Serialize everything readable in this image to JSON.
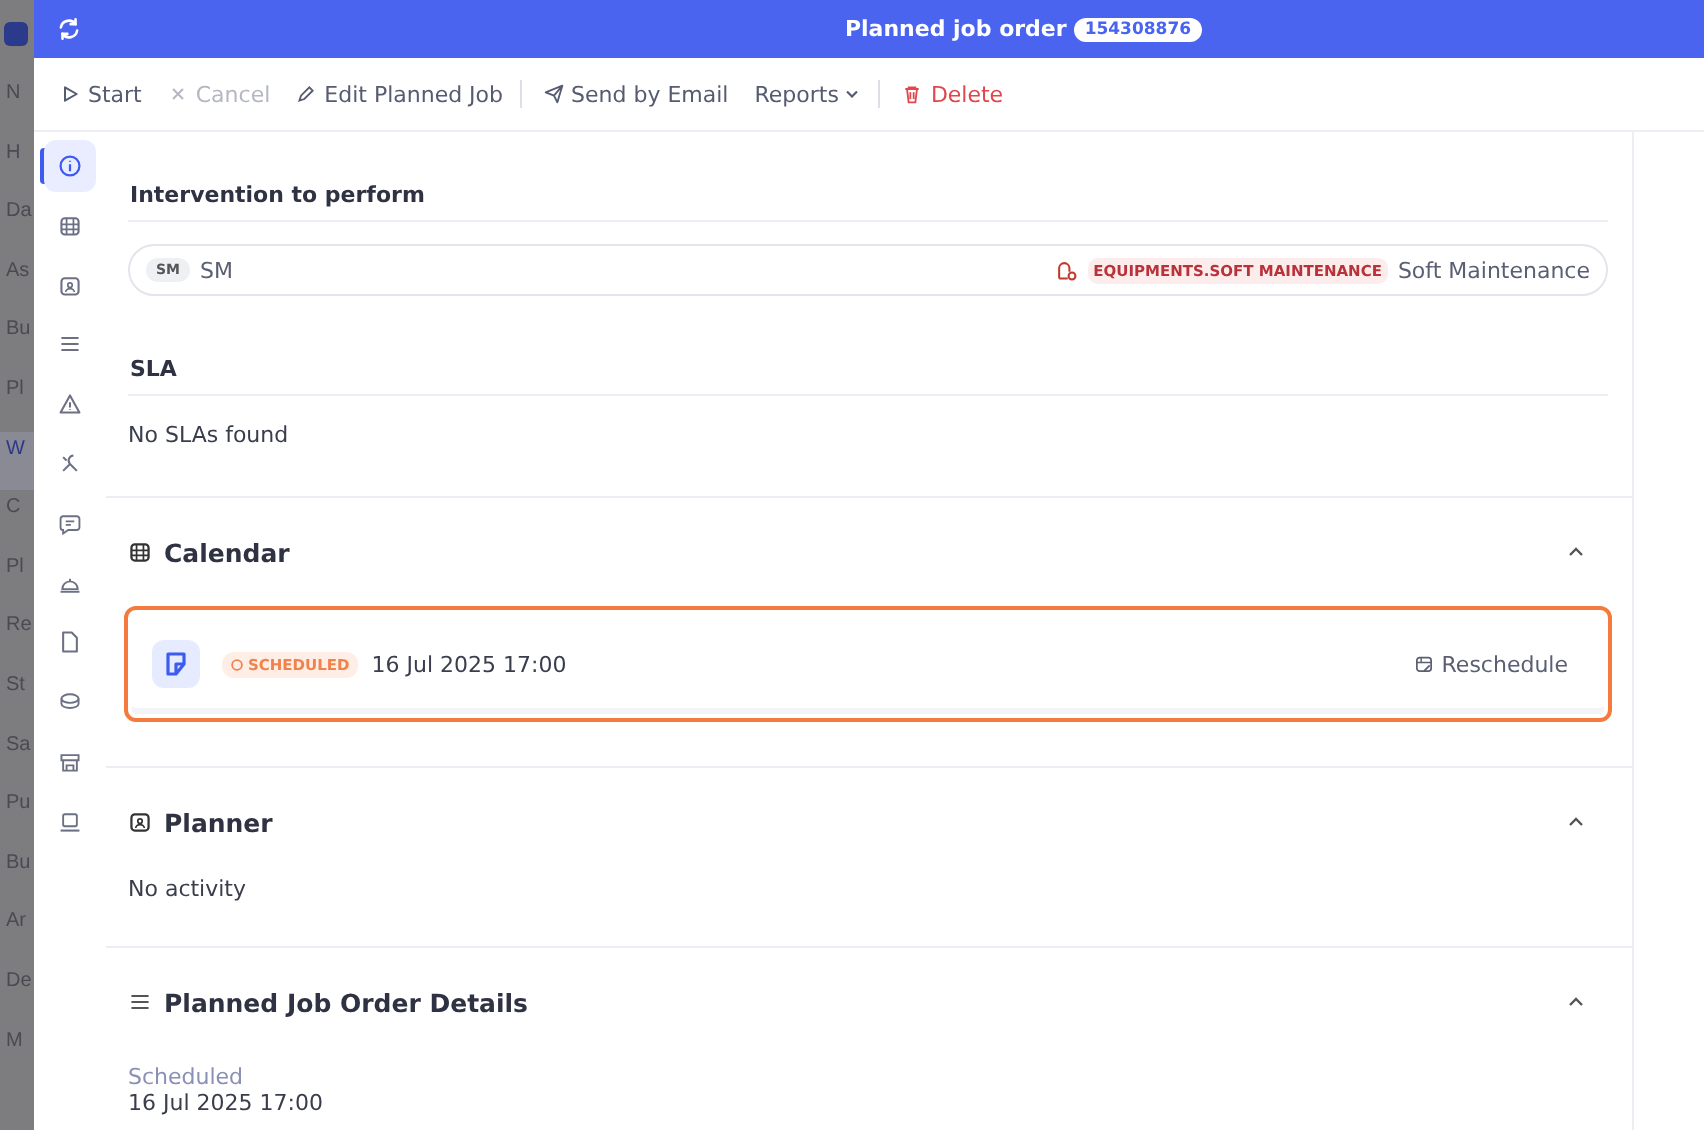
{
  "backdrop_nav": [
    {
      "label": "N",
      "selected": false
    },
    {
      "label": "H",
      "selected": false
    },
    {
      "label": "Da",
      "selected": false
    },
    {
      "label": "As",
      "selected": false
    },
    {
      "label": "Bu",
      "selected": false
    },
    {
      "label": "Pl",
      "selected": false
    },
    {
      "label": "W",
      "selected": true
    },
    {
      "label": "C",
      "selected": false
    },
    {
      "label": "Pl",
      "selected": false
    },
    {
      "label": "Re",
      "selected": false
    },
    {
      "label": "St",
      "selected": false
    },
    {
      "label": "Sa",
      "selected": false
    },
    {
      "label": "Pu",
      "selected": false
    },
    {
      "label": "Bu",
      "selected": false
    },
    {
      "label": "Ar",
      "selected": false
    },
    {
      "label": "De",
      "selected": false
    },
    {
      "label": "M",
      "selected": false
    }
  ],
  "window": {
    "title": "Planned job order",
    "badge": "154308876"
  },
  "toolbar": [
    {
      "kind": "start",
      "label": "Start",
      "disabled": false
    },
    {
      "kind": "cancel",
      "label": "Cancel",
      "disabled": true
    },
    {
      "kind": "edit",
      "label": "Edit Planned Job",
      "disabled": false
    },
    {
      "kind": "email",
      "label": "Send by Email",
      "disabled": false
    },
    {
      "kind": "reports",
      "label": "Reports",
      "disabled": false
    },
    {
      "kind": "delete",
      "label": "Delete",
      "disabled": false
    }
  ],
  "rail": [
    {
      "kind": "info",
      "selected": true
    },
    {
      "kind": "calendar",
      "selected": false
    },
    {
      "kind": "planner",
      "selected": false
    },
    {
      "kind": "list",
      "selected": false
    },
    {
      "kind": "warning",
      "selected": false
    },
    {
      "kind": "tools",
      "selected": false
    },
    {
      "kind": "chat",
      "selected": false
    },
    {
      "kind": "bell",
      "selected": false
    },
    {
      "kind": "file",
      "selected": false
    },
    {
      "kind": "stack",
      "selected": false
    },
    {
      "kind": "store",
      "selected": false
    },
    {
      "kind": "laptop",
      "selected": false
    }
  ],
  "intervention": {
    "title": "Intervention to perform",
    "code": "SM",
    "name": "SM",
    "tag": "EQUIPMENTS.SOFT MAINTENANCE",
    "description": "Soft Maintenance"
  },
  "sla": {
    "title": "SLA",
    "empty": "No SLAs found"
  },
  "calendar": {
    "title": "Calendar",
    "expanded": true,
    "status": "SCHEDULED",
    "date": "16 Jul 2025 17:00",
    "action": "Reschedule"
  },
  "planner": {
    "title": "Planner",
    "expanded": true,
    "empty": "No activity"
  },
  "details": {
    "title": "Planned Job Order Details",
    "expanded": true,
    "fields": [
      {
        "label": "Scheduled",
        "value": "16 Jul 2025 17:00"
      }
    ]
  }
}
